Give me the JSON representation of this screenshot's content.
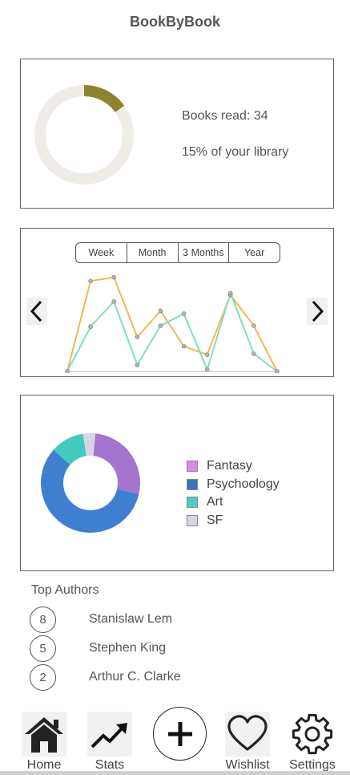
{
  "app": {
    "title": "BookByBook"
  },
  "progress": {
    "books_read_text": "Books read: 34",
    "library_text": "15% of your library",
    "fraction": 0.15,
    "colors": {
      "track": "#efebe6",
      "fill": "#8b8431"
    }
  },
  "stats": {
    "tabs": [
      "Week",
      "Month",
      "3 Months",
      "Year"
    ],
    "prev_icon": "chevron-left-icon",
    "next_icon": "chevron-right-icon",
    "chart_data": {
      "type": "line",
      "title": "",
      "xlabel": "",
      "ylabel": "",
      "grid": false,
      "x": [
        0,
        1,
        2,
        3,
        4,
        5,
        6,
        7,
        8,
        9
      ],
      "series": [
        {
          "color": "#f5b74e",
          "values": [
            0,
            9.7,
            10.1,
            3.7,
            6.5,
            2.7,
            1.8,
            8.2,
            4.9,
            0
          ]
        },
        {
          "color": "#7fe0b9",
          "values": [
            0,
            4.8,
            7.5,
            0.7,
            4.9,
            6.2,
            0.2,
            8.4,
            1.9,
            0
          ]
        }
      ],
      "ylim": [
        0,
        10.5
      ]
    }
  },
  "genres": {
    "chart_data": {
      "type": "pie",
      "title": "",
      "categories": [
        "Fantasy",
        "Psychoology",
        "Art",
        "SF"
      ],
      "values": [
        27,
        58,
        11,
        4
      ],
      "colors": [
        "#a574cf",
        "#3f7fd0",
        "#44c9bd",
        "#d8d6e6"
      ],
      "swatch_colors": [
        "#d58de4",
        "#3a72c6",
        "#48cfc0",
        "#d9d4e4"
      ],
      "legend_position": "right"
    }
  },
  "authors": {
    "title": "Top Authors",
    "items": [
      {
        "rank": "8",
        "name": "Stanislaw Lem"
      },
      {
        "rank": "5",
        "name": "Stephen King"
      },
      {
        "rank": "2",
        "name": "Arthur C. Clarke"
      }
    ]
  },
  "nav": {
    "home": {
      "label": "Home",
      "icon": "home-icon"
    },
    "stats": {
      "label": "Stats",
      "icon": "trending-up-icon"
    },
    "add": {
      "icon": "plus-icon"
    },
    "wishlist": {
      "label": "Wishlist",
      "icon": "heart-icon"
    },
    "settings": {
      "label": "Settings",
      "icon": "gear-icon"
    }
  }
}
